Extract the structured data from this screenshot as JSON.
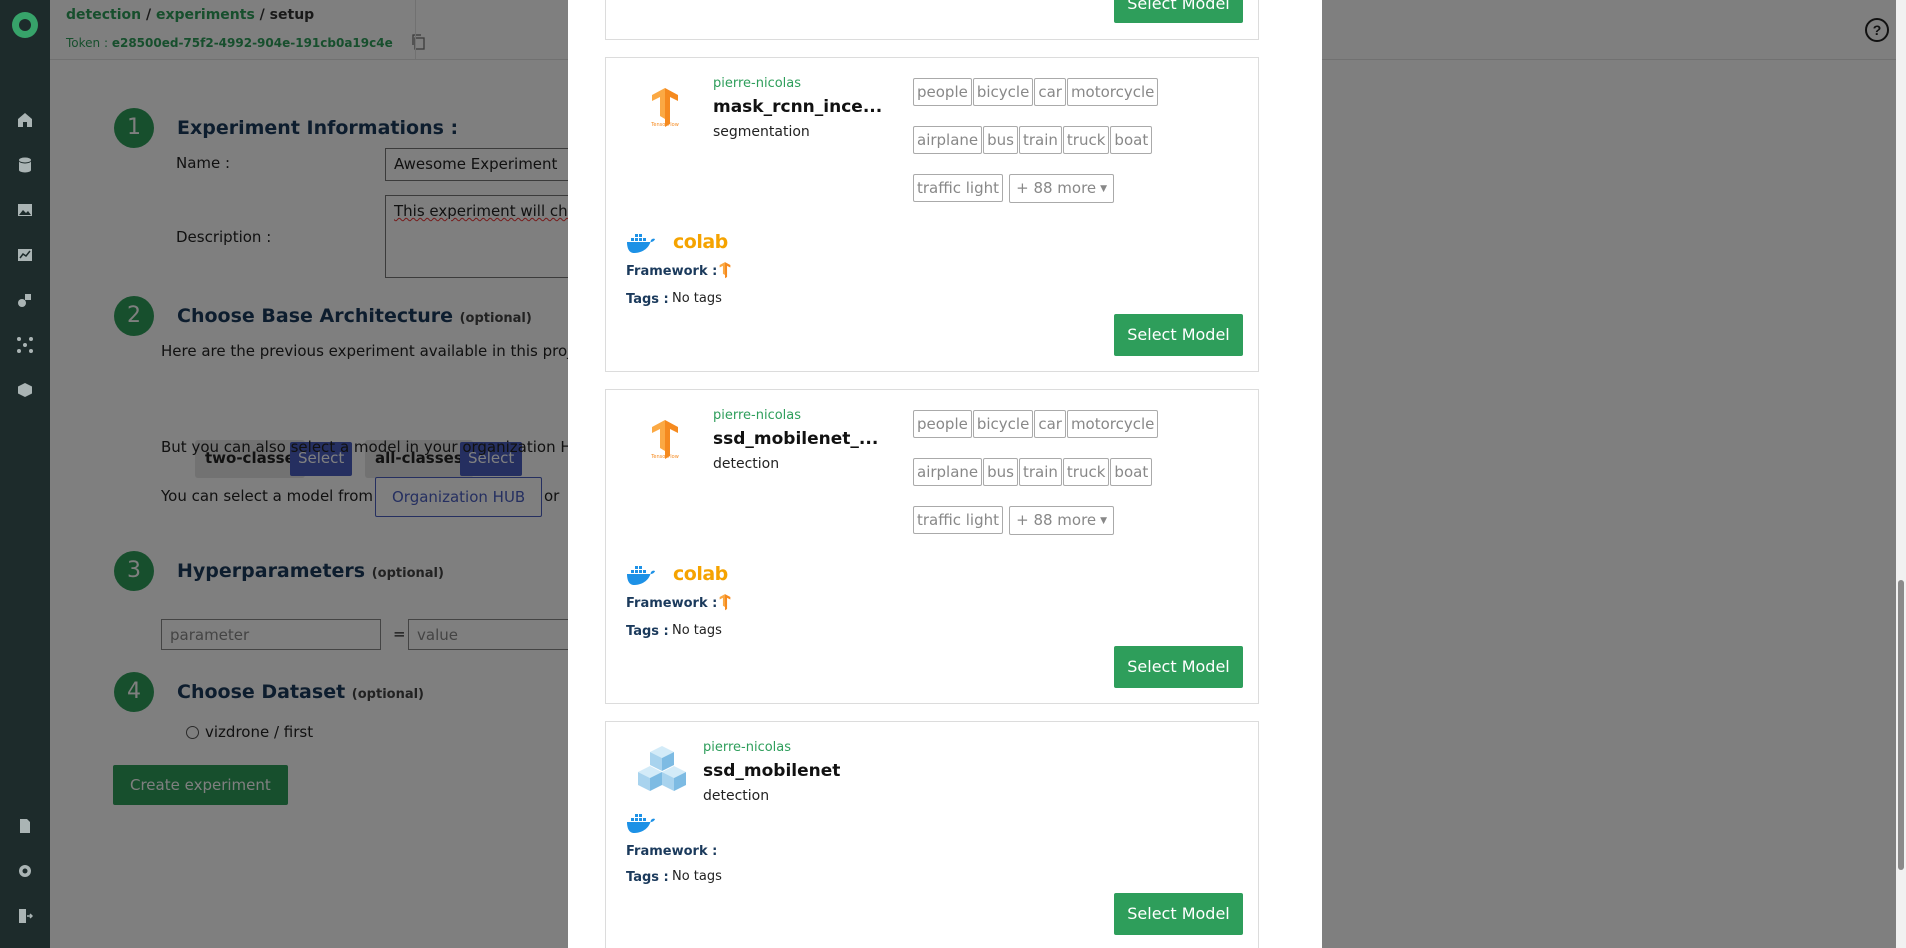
{
  "topbar": {
    "crumb1": "detection",
    "crumb2": "experiments",
    "crumb3": "setup",
    "token_label": "Token :",
    "token_value": "e28500ed-75f2-4992-904e-191cb0a19c4e"
  },
  "page": {
    "step1": {
      "num": "1",
      "title": "Experiment Informations :"
    },
    "name_label": "Name :",
    "name_value": "Awesome Experiment",
    "desc_label": "Description :",
    "desc_value": "This experiment will cha",
    "step2": {
      "num": "2",
      "title": "Choose Base Architecture",
      "optional": "(optional)"
    },
    "previous_text": "Here are the previous experiment available in this project",
    "arch": [
      {
        "name": "two-classe",
        "btn": "Select"
      },
      {
        "name": "all-classes",
        "btn": "Select"
      }
    ],
    "also_text": "But you can also select a model in your organization HUB",
    "select_from_text": "You can select a model from :",
    "org_hub_btn": "Organization HUB",
    "or_text": "or",
    "step3": {
      "num": "3",
      "title": "Hyperparameters",
      "optional": "(optional)"
    },
    "param_placeholder": "parameter",
    "equals": "=",
    "value_placeholder": "value",
    "step4": {
      "num": "4",
      "title": "Choose Dataset",
      "optional": "(optional)"
    },
    "dataset_option": "vizdrone / first",
    "create_btn": "Create experiment"
  },
  "modal": {
    "top_select_btn": "Select Model",
    "cards": [
      {
        "owner": "pierre-nicolas",
        "name": "mask_rcnn_ince...",
        "type": "segmentation",
        "labels": [
          "people",
          "bicycle",
          "car",
          "motorcycle",
          "airplane",
          "bus",
          "train",
          "truck",
          "boat",
          "traffic light"
        ],
        "more": "+ 88 more",
        "colab": "colab",
        "framework_label": "Framework :",
        "tags_label": "Tags :",
        "tags_value": "No tags",
        "select_btn": "Select Model"
      },
      {
        "owner": "pierre-nicolas",
        "name": "ssd_mobilenet_...",
        "type": "detection",
        "labels": [
          "people",
          "bicycle",
          "car",
          "motorcycle",
          "airplane",
          "bus",
          "train",
          "truck",
          "boat",
          "traffic light"
        ],
        "more": "+ 88 more",
        "colab": "colab",
        "framework_label": "Framework :",
        "tags_label": "Tags :",
        "tags_value": "No tags",
        "select_btn": "Select Model"
      },
      {
        "owner": "pierre-nicolas",
        "name": "ssd_mobilenet",
        "type": "detection",
        "framework_label": "Framework :",
        "tags_label": "Tags :",
        "tags_value": "No tags",
        "select_btn": "Select Model"
      }
    ]
  },
  "colors": {
    "brand_green": "#2e9e5b",
    "sidebar_bg": "#1d2b2b",
    "select_blue": "#4a5fc1",
    "heading_navy": "#1b3a5c",
    "tensorflow_orange": "#f58a1f",
    "docker_blue": "#1d91e6"
  }
}
